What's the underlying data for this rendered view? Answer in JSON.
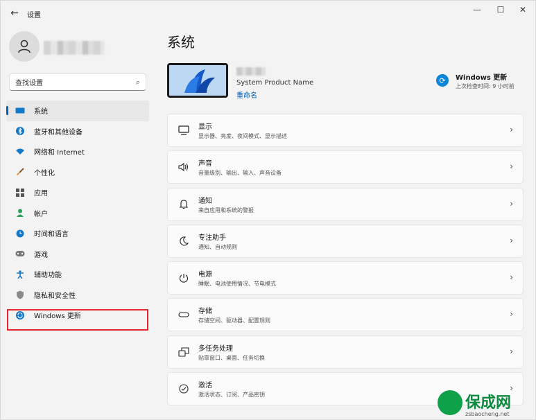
{
  "window": {
    "title": "设置",
    "back_glyph": "←",
    "min_glyph": "—",
    "max_glyph": "☐",
    "close_glyph": "✕"
  },
  "search": {
    "placeholder": "查找设置"
  },
  "nav": {
    "items": [
      {
        "label": "系统",
        "icon": "monitor-icon",
        "active": true
      },
      {
        "label": "蓝牙和其他设备",
        "icon": "bluetooth-icon"
      },
      {
        "label": "网络和 Internet",
        "icon": "wifi-icon"
      },
      {
        "label": "个性化",
        "icon": "brush-icon"
      },
      {
        "label": "应用",
        "icon": "apps-icon"
      },
      {
        "label": "帐户",
        "icon": "person-icon"
      },
      {
        "label": "时间和语言",
        "icon": "globe-clock-icon"
      },
      {
        "label": "游戏",
        "icon": "gamepad-icon"
      },
      {
        "label": "辅助功能",
        "icon": "accessibility-icon"
      },
      {
        "label": "隐私和安全性",
        "icon": "shield-icon"
      },
      {
        "label": "Windows 更新",
        "icon": "update-icon"
      }
    ]
  },
  "main": {
    "title": "系统",
    "device_model": "System Product Name",
    "rename": "重命名",
    "update": {
      "title": "Windows 更新",
      "subtitle": "上次检查时间: 9 小时前"
    },
    "cards": [
      {
        "title": "显示",
        "subtitle": "显示器、亮度、夜间模式、显示描述",
        "icon": "display-icon"
      },
      {
        "title": "声音",
        "subtitle": "音量级别、输出、输入、声音设备",
        "icon": "speaker-icon"
      },
      {
        "title": "通知",
        "subtitle": "来自应用和系统的警报",
        "icon": "bell-icon"
      },
      {
        "title": "专注助手",
        "subtitle": "通知、自动规则",
        "icon": "moon-icon"
      },
      {
        "title": "电源",
        "subtitle": "睡眠、电池使用情况、节电模式",
        "icon": "power-icon"
      },
      {
        "title": "存储",
        "subtitle": "存储空间、驱动器、配置规则",
        "icon": "storage-icon"
      },
      {
        "title": "多任务处理",
        "subtitle": "贴靠窗口、桌面、任务切换",
        "icon": "multitask-icon"
      },
      {
        "title": "激活",
        "subtitle": "激活状态、订阅、产品密钥",
        "icon": "check-circle-icon"
      }
    ],
    "chevron": "›"
  },
  "watermark": {
    "text": "保成网",
    "url": "zsbaocheng.net"
  },
  "colors": {
    "accent": "#005fb8",
    "highlight_box": "#e3262b",
    "watermark_green": "#0c8a3e"
  }
}
